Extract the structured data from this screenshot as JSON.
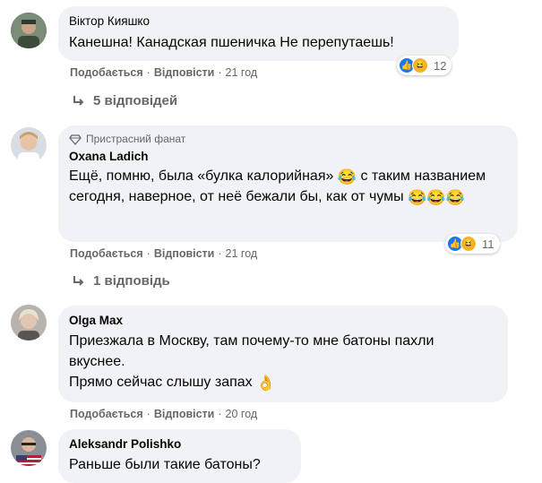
{
  "colors": {
    "bubble": "#f0f2f5",
    "meta": "#65676b",
    "like": "#1877f2",
    "haha": "#f7b125"
  },
  "comments": [
    {
      "author": "Віктор Кияшко",
      "text": [
        "Канешна! Канадская пшеничка Не перепутаешь!"
      ],
      "actions": {
        "like": "Подобається",
        "reply": "Відповісти",
        "time": "21 год"
      },
      "reactions": {
        "icons": [
          "like-icon",
          "haha-icon"
        ],
        "count": "12"
      },
      "replies": "5 відповідей"
    },
    {
      "badge": "Пристрасний фанат",
      "author": "Oxana Ladich",
      "text": [
        "Ещё, помню, была «булка калорийная» ",
        " с таким названием сегодня, наверное, от неё бежали бы, как от чумы "
      ],
      "actions": {
        "like": "Подобається",
        "reply": "Відповісти",
        "time": "21 год"
      },
      "reactions": {
        "icons": [
          "like-icon",
          "haha-icon"
        ],
        "count": "11"
      },
      "replies": "1 відповідь"
    },
    {
      "author": "Olga Max",
      "text": [
        "Приезжала в Москву, там почему-то мне батоны пахли вкуснее.",
        "Прямо сейчас слышу запах "
      ],
      "actions": {
        "like": "Подобається",
        "reply": "Відповісти",
        "time": "20 год"
      }
    },
    {
      "author": "Aleksandr Polishko",
      "text": [
        "Раньше были такие батоны?"
      ]
    }
  ]
}
